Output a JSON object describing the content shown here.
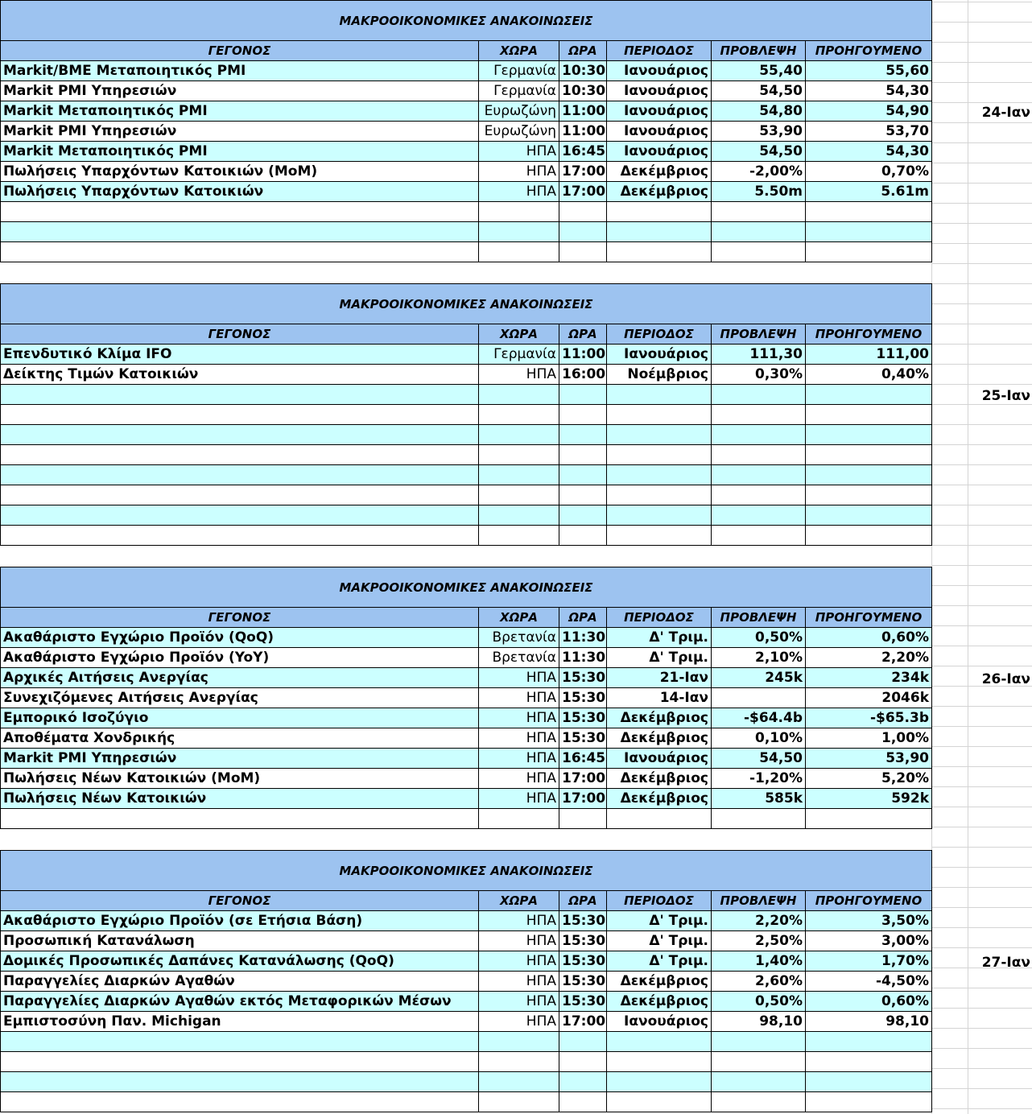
{
  "blocks": [
    {
      "title": "ΜΑΚΡΟΟΙΚΟΝΟΜΙΚΕΣ ΑΝΑΚΟΙΝΩΣΕΙΣ",
      "headers": [
        "ΓΕΓΟΝΟΣ",
        "ΧΩΡΑ",
        "ΩΡΑ",
        "ΠΕΡΙΟΔΟΣ",
        "ΠΡΟΒΛΕΨΗ",
        "ΠΡΟΗΓΟΥΜΕΝΟ"
      ],
      "date": "24-Ιαν",
      "rows": [
        [
          "Markit/BME Μεταποιητικός PMI",
          "Γερμανία",
          "10:30",
          "Ιανουάριος",
          "55,40",
          "55,60"
        ],
        [
          "Markit PMI Υπηρεσιών",
          "Γερμανία",
          "10:30",
          "Ιανουάριος",
          "54,50",
          "54,30"
        ],
        [
          "Markit Μεταποιητικός PMI",
          "Ευρωζώνη",
          "11:00",
          "Ιανουάριος",
          "54,80",
          "54,90"
        ],
        [
          "Markit PMI Υπηρεσιών",
          "Ευρωζώνη",
          "11:00",
          "Ιανουάριος",
          "53,90",
          "53,70"
        ],
        [
          "Markit Μεταποιητικός PMI",
          "ΗΠΑ",
          "16:45",
          "Ιανουάριος",
          "54,50",
          "54,30"
        ],
        [
          "Πωλήσεις Υπαρχόντων Κατοικιών (MoM)",
          "ΗΠΑ",
          "17:00",
          "Δεκέμβριος",
          "-2,00%",
          "0,70%"
        ],
        [
          "Πωλήσεις Υπαρχόντων Κατοικιών",
          "ΗΠΑ",
          "17:00",
          "Δεκέμβριος",
          "5.50m",
          "5.61m"
        ],
        [
          "",
          "",
          "",
          "",
          "",
          ""
        ],
        [
          "",
          "",
          "",
          "",
          "",
          ""
        ],
        [
          "",
          "",
          "",
          "",
          "",
          ""
        ]
      ]
    },
    {
      "title": "ΜΑΚΡΟΟΙΚΟΝΟΜΙΚΕΣ ΑΝΑΚΟΙΝΩΣΕΙΣ",
      "headers": [
        "ΓΕΓΟΝΟΣ",
        "ΧΩΡΑ",
        "ΩΡΑ",
        "ΠΕΡΙΟΔΟΣ",
        "ΠΡΟΒΛΕΨΗ",
        "ΠΡΟΗΓΟΥΜΕΝΟ"
      ],
      "date": "25-Ιαν",
      "rows": [
        [
          "Επενδυτικό Κλίμα IFO",
          "Γερμανία",
          "11:00",
          "Ιανουάριος",
          "111,30",
          "111,00"
        ],
        [
          "Δείκτης Τιμών Κατοικιών",
          "ΗΠΑ",
          "16:00",
          "Νοέμβριος",
          "0,30%",
          "0,40%"
        ],
        [
          "",
          "",
          "",
          "",
          "",
          ""
        ],
        [
          "",
          "",
          "",
          "",
          "",
          ""
        ],
        [
          "",
          "",
          "",
          "",
          "",
          ""
        ],
        [
          "",
          "",
          "",
          "",
          "",
          ""
        ],
        [
          "",
          "",
          "",
          "",
          "",
          ""
        ],
        [
          "",
          "",
          "",
          "",
          "",
          ""
        ],
        [
          "",
          "",
          "",
          "",
          "",
          ""
        ],
        [
          "",
          "",
          "",
          "",
          "",
          ""
        ]
      ]
    },
    {
      "title": "ΜΑΚΡΟΟΙΚΟΝΟΜΙΚΕΣ ΑΝΑΚΟΙΝΩΣΕΙΣ",
      "headers": [
        "ΓΕΓΟΝΟΣ",
        "ΧΩΡΑ",
        "ΩΡΑ",
        "ΠΕΡΙΟΔΟΣ",
        "ΠΡΟΒΛΕΨΗ",
        "ΠΡΟΗΓΟΥΜΕΝΟ"
      ],
      "date": "26-Ιαν",
      "rows": [
        [
          "Ακαθάριστο Εγχώριο Προϊόν (QoQ)",
          "Βρετανία",
          "11:30",
          "Δ' Τριμ.",
          "0,50%",
          "0,60%"
        ],
        [
          "Ακαθάριστο Εγχώριο Προϊόν (YoY)",
          "Βρετανία",
          "11:30",
          "Δ' Τριμ.",
          "2,10%",
          "2,20%"
        ],
        [
          "Αρχικές Αιτήσεις Ανεργίας",
          "ΗΠΑ",
          "15:30",
          "21-Ιαν",
          "245k",
          "234k"
        ],
        [
          "Συνεχιζόμενες Αιτήσεις Ανεργίας",
          "ΗΠΑ",
          "15:30",
          "14-Ιαν",
          "",
          "2046k"
        ],
        [
          "Εμπορικό Ισοζύγιο",
          "ΗΠΑ",
          "15:30",
          "Δεκέμβριος",
          "-$64.4b",
          "-$65.3b"
        ],
        [
          "Αποθέματα Χονδρικής",
          "ΗΠΑ",
          "15:30",
          "Δεκέμβριος",
          "0,10%",
          "1,00%"
        ],
        [
          "Markit PMI Υπηρεσιών",
          "ΗΠΑ",
          "16:45",
          "Ιανουάριος",
          "54,50",
          "53,90"
        ],
        [
          "Πωλήσεις Νέων Κατοικιών (MoM)",
          "ΗΠΑ",
          "17:00",
          "Δεκέμβριος",
          "-1,20%",
          "5,20%"
        ],
        [
          "Πωλήσεις Νέων Κατοικιών",
          "ΗΠΑ",
          "17:00",
          "Δεκέμβριος",
          "585k",
          "592k"
        ],
        [
          "",
          "",
          "",
          "",
          "",
          ""
        ]
      ]
    },
    {
      "title": "ΜΑΚΡΟΟΙΚΟΝΟΜΙΚΕΣ ΑΝΑΚΟΙΝΩΣΕΙΣ",
      "headers": [
        "ΓΕΓΟΝΟΣ",
        "ΧΩΡΑ",
        "ΩΡΑ",
        "ΠΕΡΙΟΔΟΣ",
        "ΠΡΟΒΛΕΨΗ",
        "ΠΡΟΗΓΟΥΜΕΝΟ"
      ],
      "date": "27-Ιαν",
      "rows": [
        [
          "Ακαθάριστο Εγχώριο Προϊόν (σε Ετήσια Βάση)",
          "ΗΠΑ",
          "15:30",
          "Δ' Τριμ.",
          "2,20%",
          "3,50%"
        ],
        [
          "Προσωπική Κατανάλωση",
          "ΗΠΑ",
          "15:30",
          "Δ' Τριμ.",
          "2,50%",
          "3,00%"
        ],
        [
          "Δομικές Προσωπικές Δαπάνες Κατανάλωσης (QoQ)",
          "ΗΠΑ",
          "15:30",
          "Δ' Τριμ.",
          "1,40%",
          "1,70%"
        ],
        [
          "Παραγγελίες Διαρκών Αγαθών",
          "ΗΠΑ",
          "15:30",
          "Δεκέμβριος",
          "2,60%",
          "-4,50%"
        ],
        [
          "Παραγγελίες Διαρκών Αγαθών εκτός Μεταφορικών Μέσων",
          "ΗΠΑ",
          "15:30",
          "Δεκέμβριος",
          "0,50%",
          "0,60%"
        ],
        [
          "Εμπιστοσύνη Παν. Michigan",
          "ΗΠΑ",
          "17:00",
          "Ιανουάριος",
          "98,10",
          "98,10"
        ],
        [
          "",
          "",
          "",
          "",
          "",
          ""
        ],
        [
          "",
          "",
          "",
          "",
          "",
          ""
        ],
        [
          "",
          "",
          "",
          "",
          "",
          ""
        ],
        [
          "",
          "",
          "",
          "",
          "",
          ""
        ]
      ]
    }
  ]
}
